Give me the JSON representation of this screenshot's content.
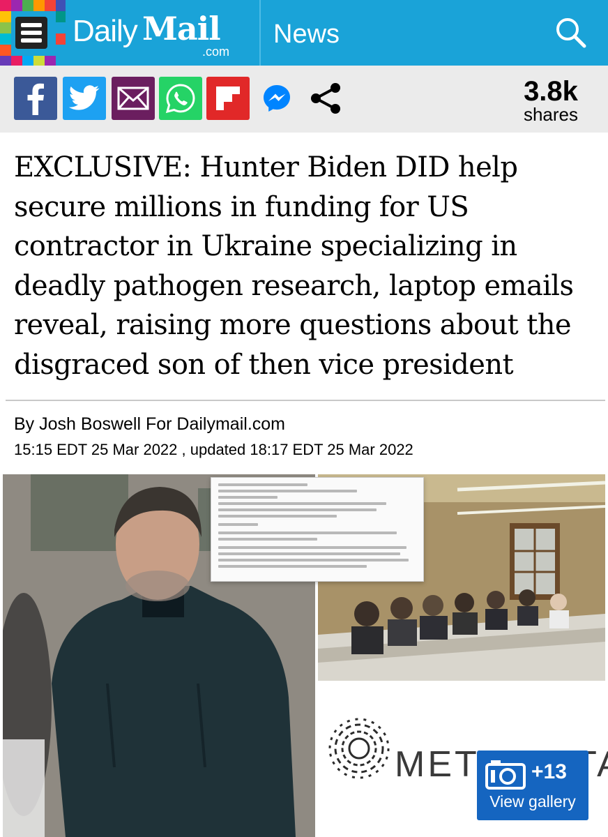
{
  "header": {
    "logo_daily": "Daily",
    "logo_mail": "Mail",
    "logo_dotcom": ".com",
    "section": "News",
    "colors": {
      "background": "#1aa3d8"
    }
  },
  "share_bar": {
    "buttons": [
      {
        "name": "facebook",
        "icon": "facebook-icon",
        "color": "#3b5998"
      },
      {
        "name": "twitter",
        "icon": "twitter-icon",
        "color": "#1da1f2"
      },
      {
        "name": "email",
        "icon": "email-icon",
        "color": "#6b1e5f"
      },
      {
        "name": "whatsapp",
        "icon": "whatsapp-icon",
        "color": "#25d366"
      },
      {
        "name": "flipboard",
        "icon": "flipboard-icon",
        "color": "#e12828"
      },
      {
        "name": "messenger",
        "icon": "messenger-icon",
        "color": "#0084ff"
      },
      {
        "name": "share",
        "icon": "share-icon",
        "color": "#000000"
      }
    ],
    "count": "3.8k",
    "count_label": "shares"
  },
  "article": {
    "headline": "EXCLUSIVE: Hunter Biden DID help secure millions in funding for US contractor in Ukraine specializing in deadly pathogen research, laptop emails reveal, raising more questions about the disgraced son of then vice president",
    "byline": "By Josh Boswell For Dailymail.com",
    "dateline": "15:15 EDT 25 Mar 2022 , updated 18:17 EDT 25 Mar 2022"
  },
  "hero": {
    "logo_text": "METABIOTA",
    "gallery_count": "+13",
    "gallery_label": "View gallery"
  }
}
